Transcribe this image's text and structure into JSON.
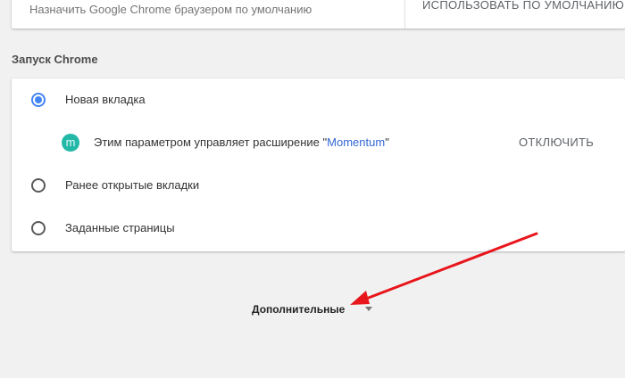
{
  "default_browser": {
    "label": "Назначить Google Chrome браузером по умолчанию",
    "button": "ИСПОЛЬЗОВАТЬ ПО УМОЛЧАНИЮ"
  },
  "startup": {
    "section_title": "Запуск Chrome",
    "options": [
      {
        "label": "Новая вкладка",
        "checked": true
      },
      {
        "label": "Ранее открытые вкладки",
        "checked": false
      },
      {
        "label": "Заданные страницы",
        "checked": false
      }
    ],
    "extension": {
      "icon_letter": "m",
      "text_prefix": "Этим параметром управляет расширение ",
      "quote_open": "\"",
      "name": "Momentum",
      "quote_close": "\"",
      "button": "ОТКЛЮЧИТЬ"
    }
  },
  "advanced": {
    "label": "Дополнительные"
  },
  "colors": {
    "accent": "#4285f4",
    "annotation_arrow": "#e8151b",
    "extension_icon": "#23b8a8"
  }
}
